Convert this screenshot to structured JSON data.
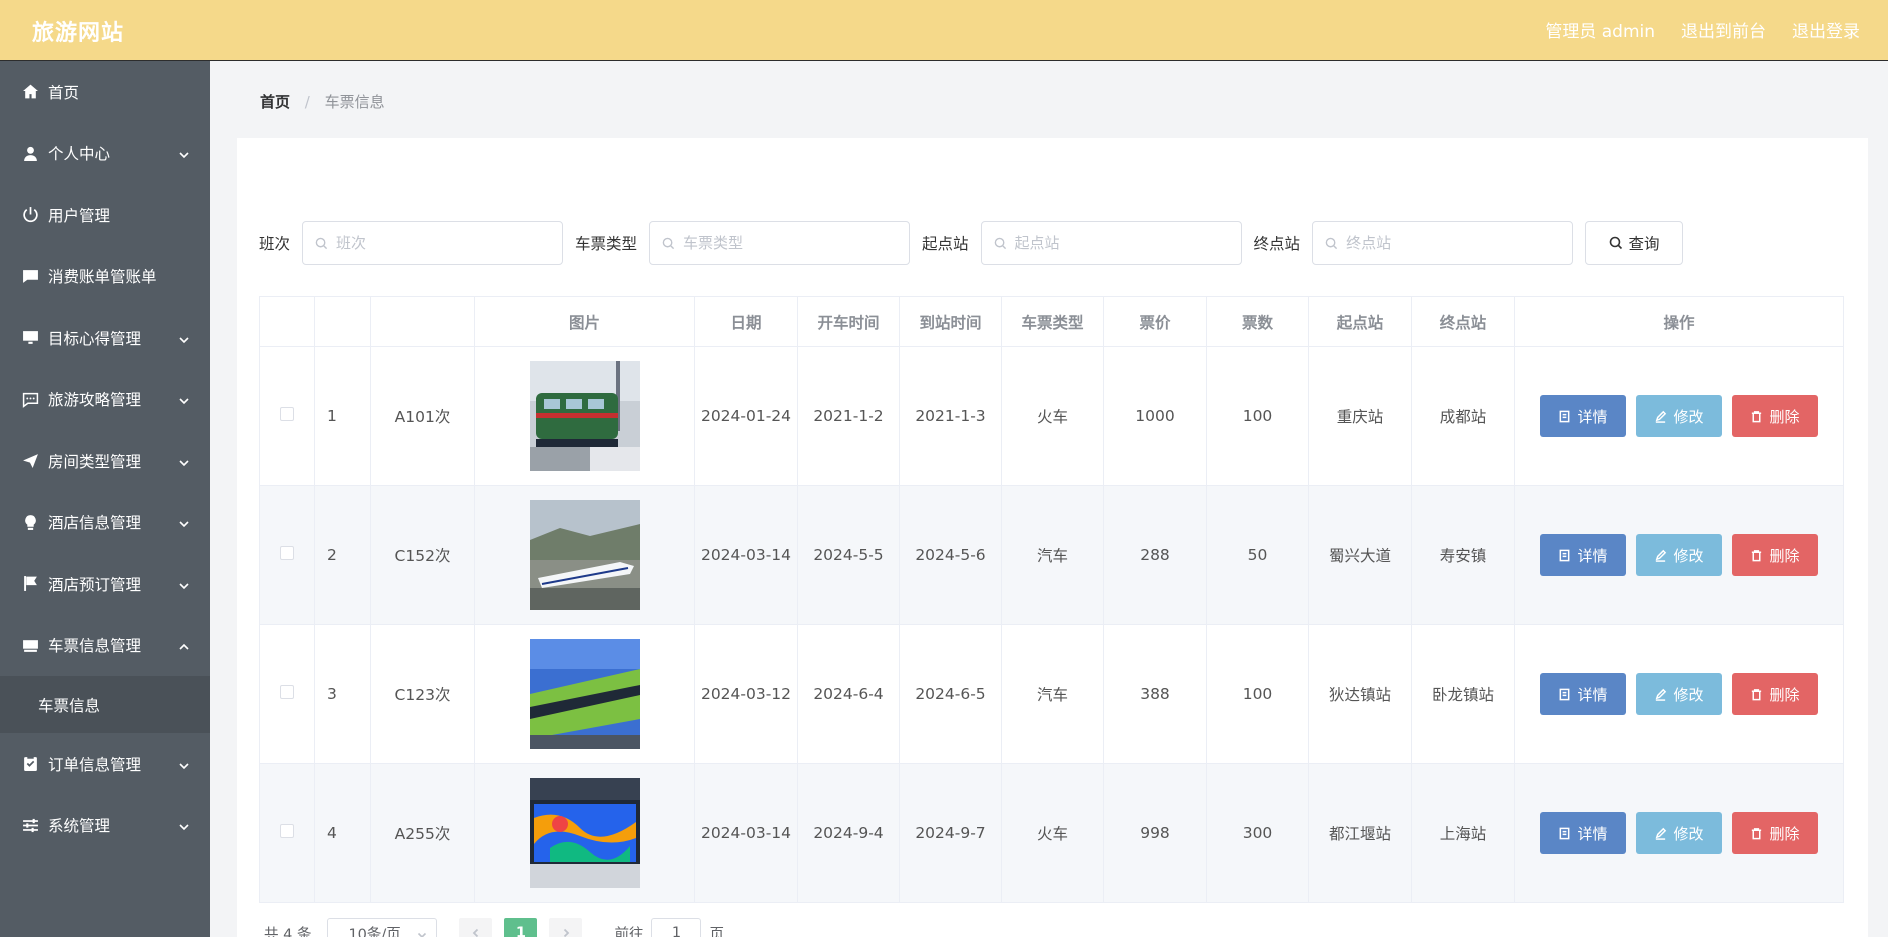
{
  "header": {
    "logo": "旅游网站",
    "admin_label": "管理员 admin",
    "to_front": "退出到前台",
    "logout": "退出登录"
  },
  "sidebar": {
    "items": [
      {
        "label": "首页",
        "icon": "home-icon",
        "expand": false
      },
      {
        "label": "个人中心",
        "icon": "user-icon",
        "expand": true
      },
      {
        "label": "用户管理",
        "icon": "power-icon",
        "expand": false
      },
      {
        "label": "消费账单管账单",
        "icon": "chat-icon",
        "expand": false
      },
      {
        "label": "目标心得管理",
        "icon": "monitor-icon",
        "expand": true
      },
      {
        "label": "旅游攻略管理",
        "icon": "message-icon",
        "expand": true
      },
      {
        "label": "房间类型管理",
        "icon": "send-icon",
        "expand": true
      },
      {
        "label": "酒店信息管理",
        "icon": "bulb-icon",
        "expand": true
      },
      {
        "label": "酒店预订管理",
        "icon": "flag-icon",
        "expand": true
      },
      {
        "label": "车票信息管理",
        "icon": "ticket-icon",
        "expand": true,
        "open": true
      }
    ],
    "sub_item": "车票信息",
    "items_after": [
      {
        "label": "订单信息管理",
        "icon": "order-icon",
        "expand": true
      },
      {
        "label": "系统管理",
        "icon": "settings-icon",
        "expand": true
      }
    ]
  },
  "breadcrumb": {
    "home": "首页",
    "separator": "/",
    "current": "车票信息"
  },
  "search": {
    "banci_label": "班次",
    "banci_placeholder": "班次",
    "type_label": "车票类型",
    "type_placeholder": "车票类型",
    "start_label": "起点站",
    "start_placeholder": "起点站",
    "end_label": "终点站",
    "end_placeholder": "终点站",
    "query": "查询"
  },
  "table": {
    "headers": [
      "",
      "",
      "",
      "图片",
      "日期",
      "开车时间",
      "到站时间",
      "车票类型",
      "票价",
      "票数",
      "起点站",
      "终点站",
      "操作"
    ],
    "rows": [
      {
        "index": "1",
        "banci": "A101次",
        "image": "green-locomotive",
        "date": "2024-01-24",
        "depart": "2021-1-2",
        "arrive": "2021-1-3",
        "type": "火车",
        "price": "1000",
        "count": "100",
        "start": "重庆站",
        "end": "成都站"
      },
      {
        "index": "2",
        "banci": "C152次",
        "image": "white-bullet-train",
        "date": "2024-03-14",
        "depart": "2024-5-5",
        "arrive": "2024-5-6",
        "type": "汽车",
        "price": "288",
        "count": "50",
        "start": "蜀兴大道",
        "end": "寿安镇"
      },
      {
        "index": "3",
        "banci": "C123次",
        "image": "green-tram",
        "date": "2024-03-12",
        "depart": "2024-6-4",
        "arrive": "2024-6-5",
        "type": "汽车",
        "price": "388",
        "count": "100",
        "start": "狄达镇站",
        "end": "卧龙镇站"
      },
      {
        "index": "4",
        "banci": "A255次",
        "image": "painted-metro-train",
        "date": "2024-03-14",
        "depart": "2024-9-4",
        "arrive": "2024-9-7",
        "type": "火车",
        "price": "998",
        "count": "300",
        "start": "都江堰站",
        "end": "上海站"
      }
    ],
    "actions": {
      "detail": "详情",
      "edit": "修改",
      "delete": "删除"
    }
  },
  "pager": {
    "total": "共 4 条",
    "page_size": "10条/页",
    "current_page": "1",
    "goto_prefix": "前往",
    "goto_value": "1",
    "goto_suffix": "页"
  },
  "colors": {
    "topbar": "#f5d98a",
    "sidebar": "#545c64",
    "detail_button": "#5a86c6",
    "edit_button": "#7cbbdc",
    "delete_button": "#e36565",
    "active_page": "#5fbf8d"
  }
}
